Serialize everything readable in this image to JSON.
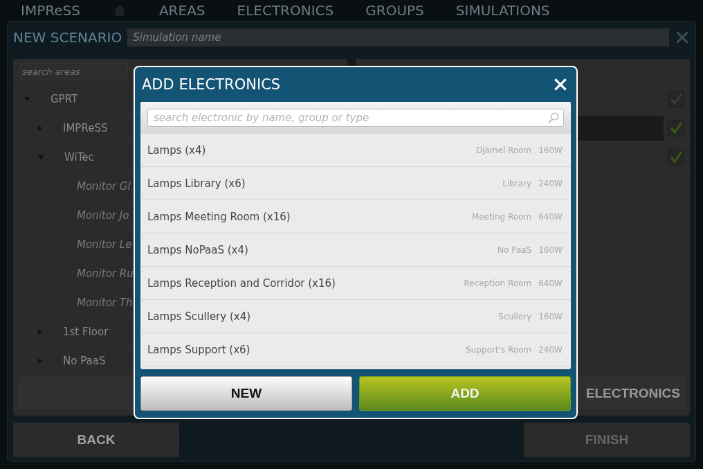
{
  "nav": {
    "brand": "IMPReSS",
    "items": [
      {
        "label": "AREAS"
      },
      {
        "label": "ELECTRONICS"
      },
      {
        "label": "GROUPS"
      },
      {
        "label": "SIMULATIONS"
      }
    ]
  },
  "scenario": {
    "title": "NEW SCENARIO",
    "name_placeholder": "Simulation name"
  },
  "areas": {
    "search_placeholder": "search areas",
    "tree": [
      {
        "label": "GPRT",
        "expanded": true,
        "children": [
          {
            "label": "IMPReSS",
            "expanded": false
          },
          {
            "label": "WiTec",
            "expanded": true,
            "children": [
              {
                "label": "Monitor Gl"
              },
              {
                "label": "Monitor Jo"
              },
              {
                "label": "Monitor Le"
              },
              {
                "label": "Monitor Ru"
              },
              {
                "label": "Monitor Th"
              }
            ]
          },
          {
            "label": "1st Floor",
            "expanded": false
          },
          {
            "label": "No PaaS",
            "expanded": false
          }
        ]
      }
    ]
  },
  "selection": {
    "rows": [
      {
        "checked": false,
        "selected": false
      },
      {
        "checked": true,
        "selected": true
      },
      {
        "checked": true,
        "selected": false
      }
    ],
    "button": "ELECTRONICS"
  },
  "footer": {
    "back": "BACK",
    "finish": "FINISH",
    "finish_disabled": true
  },
  "dialog": {
    "title": "ADD ELECTRONICS",
    "search_placeholder": "search electronic by name, group or type",
    "items": [
      {
        "name": "Lamps (x4)",
        "room": "Djamel Room",
        "power": "160W"
      },
      {
        "name": "Lamps Library (x6)",
        "room": "Library",
        "power": "240W"
      },
      {
        "name": "Lamps Meeting Room (x16)",
        "room": "Meeting Room",
        "power": "640W"
      },
      {
        "name": "Lamps NoPaaS (x4)",
        "room": "No PaaS",
        "power": "160W"
      },
      {
        "name": "Lamps Reception and Corridor (x16)",
        "room": "Reception Room",
        "power": "640W"
      },
      {
        "name": "Lamps Scullery (x4)",
        "room": "Scullery",
        "power": "160W"
      },
      {
        "name": "Lamps Support (x6)",
        "room": "Support's Room",
        "power": "240W"
      }
    ],
    "new_button": "NEW",
    "add_button": "ADD"
  }
}
